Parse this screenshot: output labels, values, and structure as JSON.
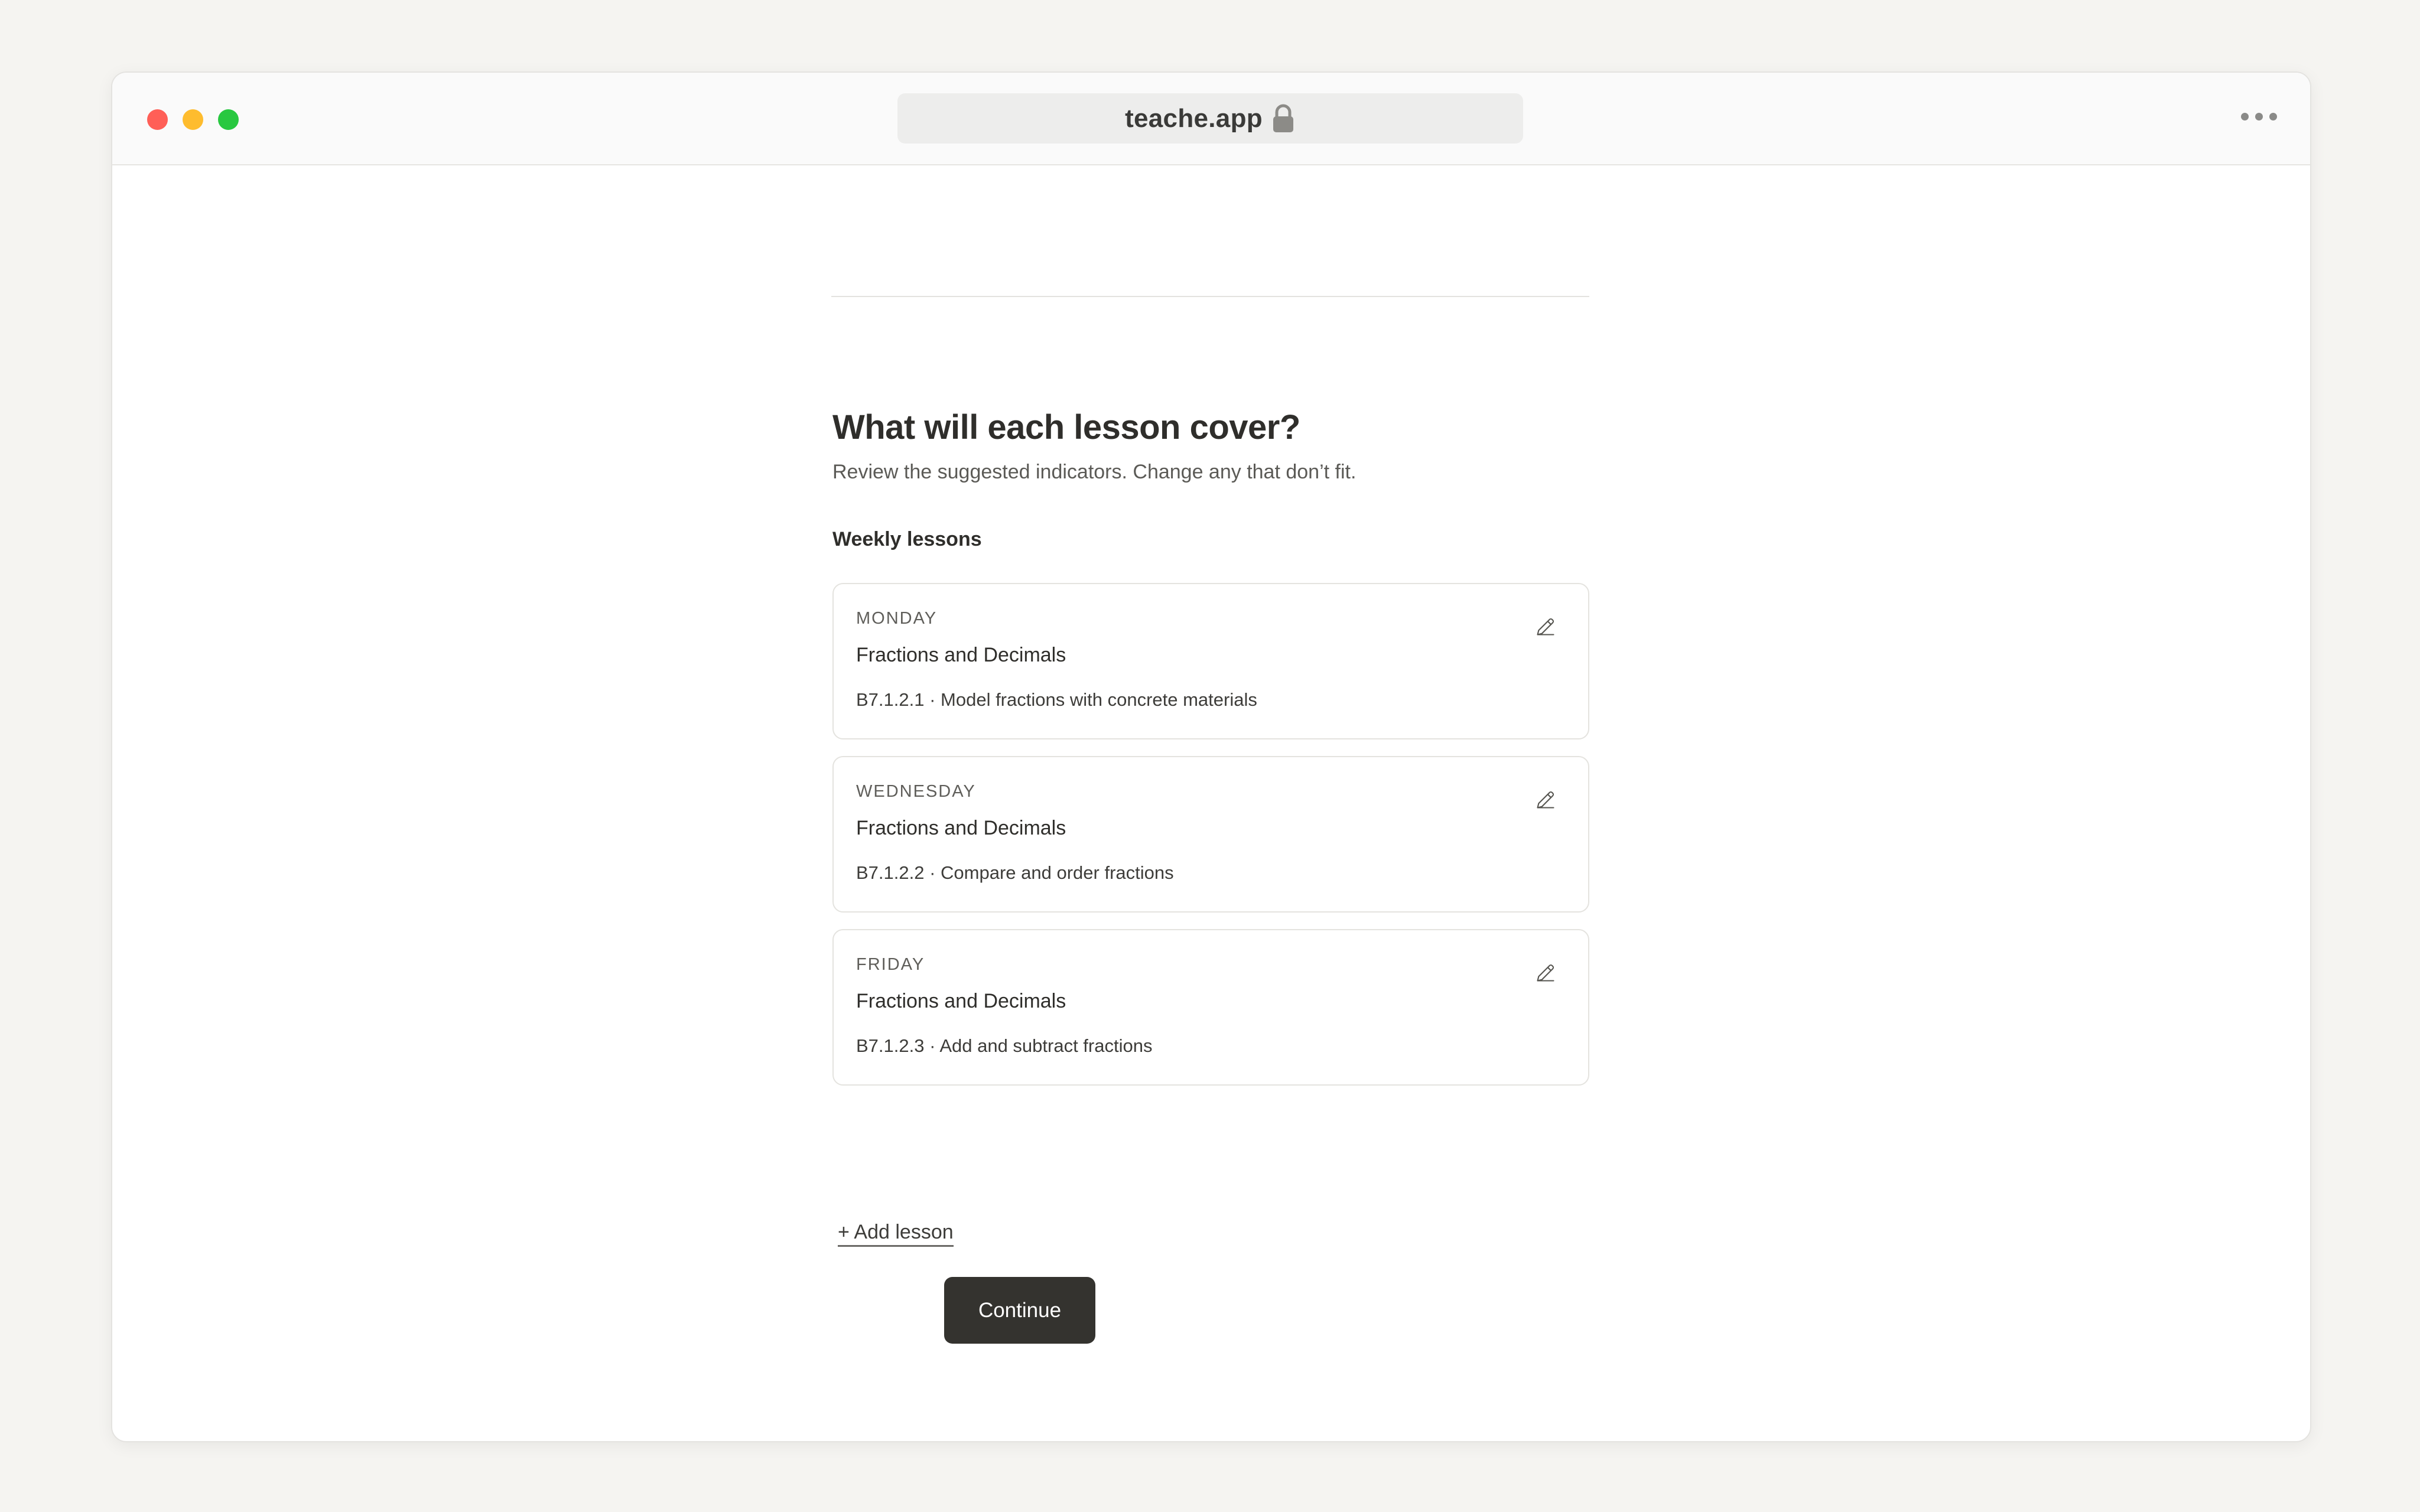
{
  "browser": {
    "url": "teache.app",
    "lock_icon": "lock-icon",
    "more_icon": "ellipsis-icon",
    "traffic_lights": {
      "close": "#ff5f57",
      "minimize": "#febc2e",
      "zoom": "#28c840"
    }
  },
  "page": {
    "title": "What will each lesson cover?",
    "subtitle": "Review the suggested indicators. Change any that don’t fit.",
    "section_label": "Weekly lessons"
  },
  "lessons": [
    {
      "day": "MONDAY",
      "subject": "Fractions and Decimals",
      "indicator": "B7.1.2.1 · Model fractions with concrete materials"
    },
    {
      "day": "WEDNESDAY",
      "subject": "Fractions and Decimals",
      "indicator": "B7.1.2.2 · Compare and order fractions"
    },
    {
      "day": "FRIDAY",
      "subject": "Fractions and Decimals",
      "indicator": "B7.1.2.3 · Add and subtract fractions"
    }
  ],
  "actions": {
    "add_lesson_label": "+ Add lesson",
    "continue_label": "Continue"
  },
  "colors": {
    "primary_button": "#34332f",
    "background": "#f5f4f1"
  }
}
